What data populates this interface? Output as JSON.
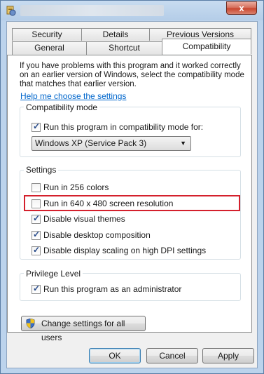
{
  "window": {
    "close_glyph": "x"
  },
  "tabs": {
    "row1": [
      {
        "label": "Security"
      },
      {
        "label": "Details"
      },
      {
        "label": "Previous Versions"
      }
    ],
    "row2": [
      {
        "label": "General"
      },
      {
        "label": "Shortcut"
      },
      {
        "label": "Compatibility"
      }
    ],
    "active": "Compatibility"
  },
  "intro": {
    "text": "If you have problems with this program and it worked correctly on an earlier version of Windows, select the compatibility mode that matches that earlier version.",
    "help_link": "Help me choose the settings"
  },
  "compat_mode": {
    "title": "Compatibility mode",
    "checkbox_label": "Run this program in compatibility mode for:",
    "checked": true,
    "selected_os": "Windows XP (Service Pack 3)"
  },
  "settings": {
    "title": "Settings",
    "options": [
      {
        "label": "Run in 256 colors",
        "checked": false
      },
      {
        "label": "Run in 640 x 480 screen resolution",
        "checked": false
      },
      {
        "label": "Disable visual themes",
        "checked": true
      },
      {
        "label": "Disable desktop composition",
        "checked": true
      },
      {
        "label": "Disable display scaling on high DPI settings",
        "checked": true
      }
    ]
  },
  "privilege": {
    "title": "Privilege Level",
    "checkbox_label": "Run this program as an administrator",
    "checked": true
  },
  "change_all_users_button": "Change settings for all users",
  "footer": {
    "ok": "OK",
    "cancel": "Cancel",
    "apply": "Apply"
  },
  "colors": {
    "highlight_border": "#d4202c",
    "link": "#0066cc",
    "check_mark": "#274a8a"
  }
}
